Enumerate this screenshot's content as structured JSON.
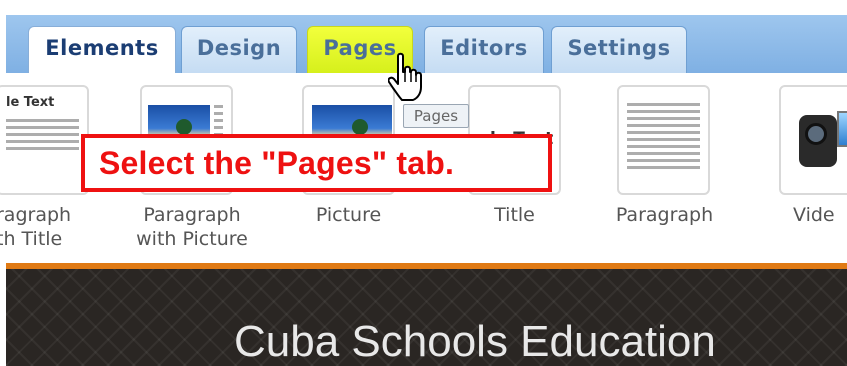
{
  "tabs": [
    {
      "label": "Elements",
      "state": "active"
    },
    {
      "label": "Design",
      "state": "normal"
    },
    {
      "label": "Pages",
      "state": "highlighted"
    },
    {
      "label": "Editors",
      "state": "normal"
    },
    {
      "label": "Settings",
      "state": "normal"
    }
  ],
  "elements": [
    {
      "caption_line1": "ragraph",
      "caption_line2": "th Title",
      "heading": "le Text"
    },
    {
      "caption_line1": "Paragraph",
      "caption_line2": "with Picture"
    },
    {
      "caption_line1": "Picture"
    },
    {
      "caption_line1": "Title",
      "heading": "le Text"
    },
    {
      "caption_line1": "Paragraph"
    },
    {
      "caption_line1": "Vide"
    }
  ],
  "tooltip": "Pages",
  "callout": "Select the \"Pages\" tab.",
  "banner_title": "Cuba Schools Education",
  "colors": {
    "tab_bar": "#8fbbe9",
    "highlight": "#e6ff28",
    "callout_red": "#ee1111",
    "separator_orange": "#e07a14",
    "banner_dark": "#2a2623"
  },
  "icons": {
    "cursor": "hand-pointer-icon"
  }
}
